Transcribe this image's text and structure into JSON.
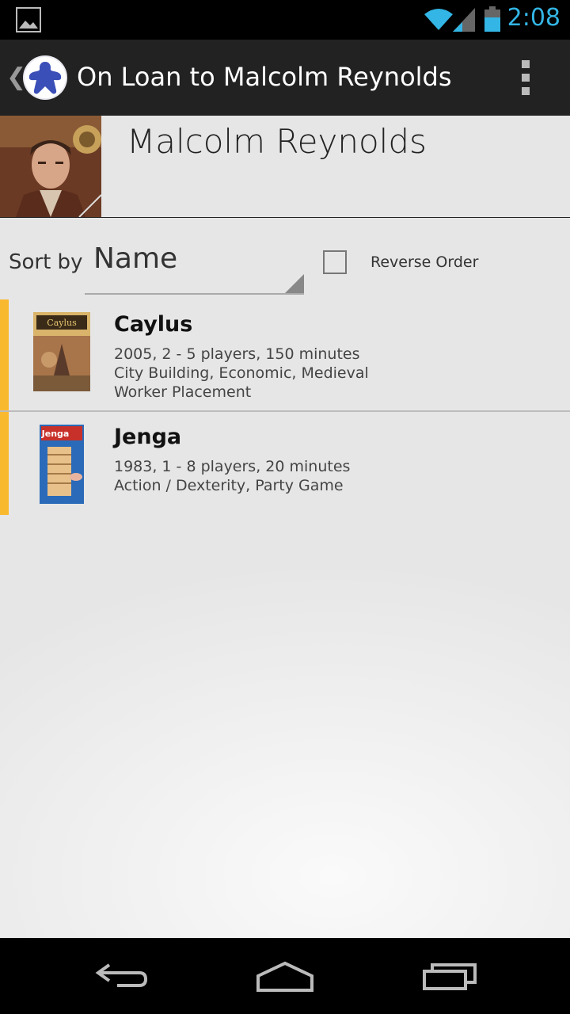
{
  "status_bar": {
    "time": "2:08",
    "icons": [
      "picture-icon",
      "wifi-icon",
      "signal-icon",
      "battery-icon"
    ]
  },
  "action_bar": {
    "title": "On Loan to Malcolm Reynolds",
    "icons": [
      "up-chevron-icon",
      "meeple-logo-icon",
      "overflow-menu-icon"
    ]
  },
  "header": {
    "name": "Malcolm Reynolds"
  },
  "sort": {
    "label": "Sort by",
    "selected": "Name",
    "reverse_label": "Reverse Order",
    "reverse_checked": false
  },
  "games": [
    {
      "title": "Caylus",
      "line1": "2005, 2 - 5 players, 150 minutes",
      "line2": "City Building, Economic, Medieval",
      "line3": "Worker Placement",
      "thumb_label": "Caylus"
    },
    {
      "title": "Jenga",
      "line1": "1983, 1 - 8 players, 20 minutes",
      "line2": "Action / Dexterity, Party Game",
      "thumb_label": "Jenga"
    }
  ],
  "colors": {
    "accent": "#f9b92f",
    "status_blue": "#33b5e5",
    "action_bar": "#222222"
  },
  "nav_bar": {
    "icons": [
      "back-icon",
      "home-icon",
      "recent-apps-icon"
    ]
  }
}
